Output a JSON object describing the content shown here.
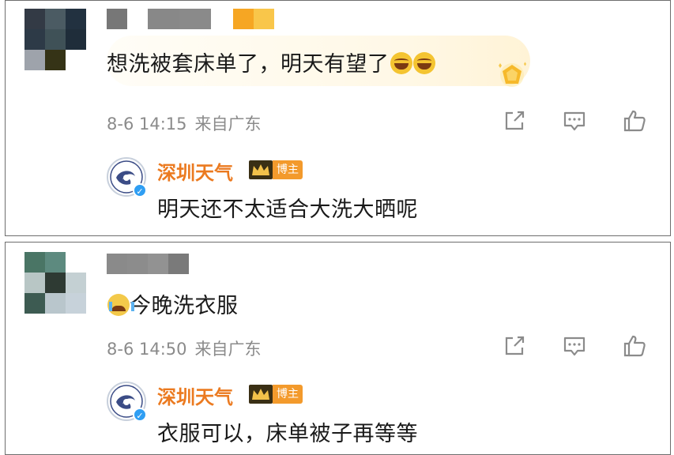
{
  "comments": [
    {
      "avatar_pixels": [
        "#333a45",
        "#4b5b63",
        "#223140",
        "#2d3a47",
        "#3f5157",
        "#1f2d3a",
        "#9ea3ab",
        "#353316",
        "#ffffff"
      ],
      "name_pixels": [
        "#777777",
        "#ffffff",
        "#888888",
        "#8a8a8a",
        "#ffffff",
        "#f6a623",
        "#f9c64a"
      ],
      "text": "想洗被套床单了，明天有望了",
      "emoji": [
        "laugh-cry",
        "laugh-cry"
      ],
      "date": "8-6 14:15",
      "location": "来自广东",
      "reply": {
        "name": "深圳天气",
        "role_tag": "博主",
        "text": "明天还不太适合大洗大晒呢"
      }
    },
    {
      "avatar_pixels": [
        "#4a7565",
        "#5d8a7f",
        "#ffffff",
        "#b8c6c5",
        "#2e3a33",
        "#c4d0d3",
        "#3d5b52",
        "#b9c6cc",
        "#c7d2da"
      ],
      "name_pixels": [
        "#8a8a8a",
        "#8c8c8c",
        "#929292",
        "#7a7a7a"
      ],
      "emoji_lead": "crying",
      "text": "今晚洗衣服",
      "date": "8-6 14:50",
      "location": "来自广东",
      "reply": {
        "name": "深圳天气",
        "role_tag": "博主",
        "text": "衣服可以，床单被子再等等"
      }
    }
  ],
  "icons": [
    "share-icon",
    "comment-icon",
    "like-icon",
    "crown-icon",
    "verified-icon",
    "badge-gem-icon"
  ],
  "colors": {
    "accent": "#eb7a20",
    "tag": "#f39a2c",
    "meta": "#8b8b8b",
    "verified": "#2f9ef3"
  }
}
